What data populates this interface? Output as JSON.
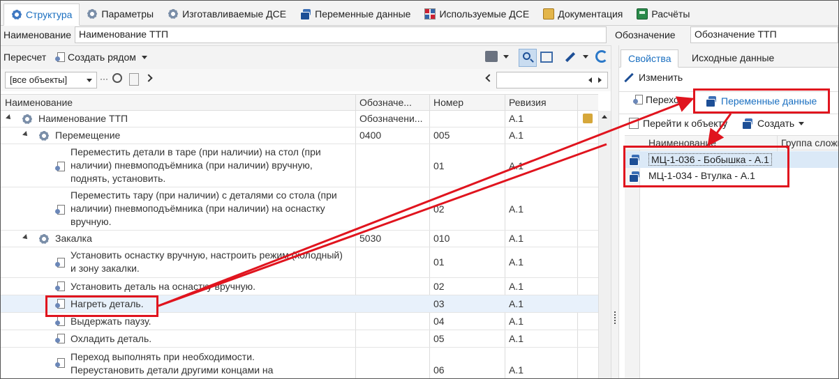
{
  "tabs": [
    {
      "label": "Структура",
      "icon": "gear-blue-icon"
    },
    {
      "label": "Параметры",
      "icon": "gear-icon"
    },
    {
      "label": "Изготавливаемые ДСЕ",
      "icon": "gear-icon"
    },
    {
      "label": "Переменные данные",
      "icon": "variable-data-icon"
    },
    {
      "label": "Используемые ДСЕ",
      "icon": "grid-icon"
    },
    {
      "label": "Документация",
      "icon": "documentation-icon"
    },
    {
      "label": "Расчёты",
      "icon": "calculator-icon"
    }
  ],
  "header": {
    "name_label": "Наименование",
    "name_value": "Наименование ТТП",
    "designation_label": "Обозначение",
    "designation_value": "Обозначение ТТП"
  },
  "toolbar": {
    "recalc_label": "Пересчет",
    "create_near_label": "Создать рядом"
  },
  "filter": {
    "selected": "[все объекты]",
    "dots": "···"
  },
  "grid": {
    "columns": [
      "Наименование",
      "Обозначе...",
      "Номер",
      "Ревизия"
    ],
    "rows": [
      {
        "name": "Наименование ТТП",
        "designation": "Обозначени...",
        "number": "",
        "revision": "A.1"
      },
      {
        "name": "Перемещение",
        "designation": "0400",
        "number": "005",
        "revision": "A.1"
      },
      {
        "name_lines": [
          "Переместить детали в таре (при наличии) на стол (при",
          "наличии) пневмоподъёмника (при наличии) вручную,",
          "поднять, установить."
        ],
        "designation": "",
        "number": "01",
        "revision": "A.1"
      },
      {
        "name_lines": [
          "Переместить тару (при наличии) с деталями со стола (при",
          "наличии) пневмоподъёмника (при наличии) на оснастку",
          "вручную."
        ],
        "designation": "",
        "number": "02",
        "revision": "A.1"
      },
      {
        "name": "Закалка",
        "designation": "5030",
        "number": "010",
        "revision": "A.1"
      },
      {
        "name_lines": [
          "Установить оснастку вручную, настроить режим (холодный)",
          "и зону закалки."
        ],
        "designation": "",
        "number": "01",
        "revision": "A.1"
      },
      {
        "name": "Установить деталь на оснастку вручную.",
        "designation": "",
        "number": "02",
        "revision": "A.1"
      },
      {
        "name": "Нагреть деталь.",
        "designation": "",
        "number": "03",
        "revision": "A.1"
      },
      {
        "name": "Выдержать паузу.",
        "designation": "",
        "number": "04",
        "revision": "A.1"
      },
      {
        "name": "Охладить деталь.",
        "designation": "",
        "number": "05",
        "revision": "A.1"
      },
      {
        "name_lines": [
          "Переход выполнять при необходимости.",
          "Переустановить детали другими концами на"
        ],
        "designation": "",
        "number": "06",
        "revision": "A.1"
      }
    ]
  },
  "right": {
    "tabs": [
      "Свойства",
      "Исходные данные"
    ],
    "edit_label": "Изменить",
    "subtabs": [
      "Переход",
      "Переменные данные"
    ],
    "goto_label": "Перейти к объекту",
    "create_label": "Создать",
    "columns": [
      "Наименование",
      "Группа сложн"
    ],
    "rows": [
      "МЦ-1-036 - Бобышка - А.1",
      "МЦ-1-034 - Втулка - А.1"
    ]
  },
  "colors": {
    "accent": "#1a6fc0",
    "highlight": "#e0141e",
    "selection": "#e8f1fb"
  }
}
